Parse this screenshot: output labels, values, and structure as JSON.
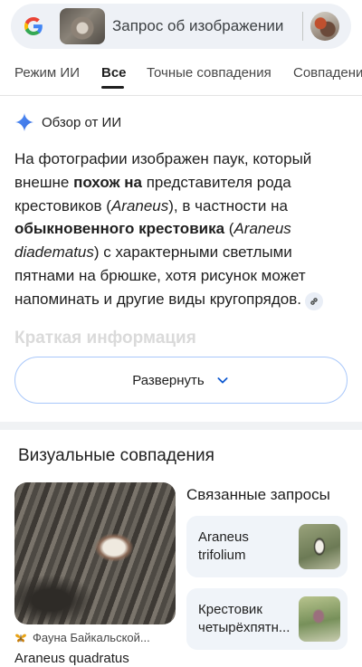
{
  "search": {
    "query_text": "Запрос об изображении",
    "logo": "google-g-icon"
  },
  "tabs": [
    {
      "label": "Режим ИИ",
      "active": false
    },
    {
      "label": "Все",
      "active": true
    },
    {
      "label": "Точные совпадения",
      "active": false
    },
    {
      "label": "Совпадени",
      "active": false
    }
  ],
  "ai_overview": {
    "title": "Обзор от ИИ",
    "icon": "gemini-sparkle-icon",
    "text_parts": {
      "p1": "На фотографии изображен паук, который внешне ",
      "b1": "похож на",
      "p2": " представителя рода крестовиков (",
      "i1": "Araneus",
      "p3": "), в частности на ",
      "b2": "обыкновенного крестовика",
      "p4": " (",
      "i2": "Araneus diadematus",
      "p5": ") с характерными светлыми пятнами на брюшке, хотя рисунок может напоминать и другие виды кругопрядов."
    },
    "faded_heading": "Краткая информация",
    "expand_label": "Развернуть"
  },
  "visual_matches": {
    "title": "Визуальные совпадения",
    "main_card": {
      "source": "Фауна Байкальской...",
      "caption": "Araneus quadratus"
    },
    "related": {
      "title": "Связанные запросы",
      "items": [
        {
          "label": "Araneus trifolium"
        },
        {
          "label": "Крестовик четырёхпятн..."
        }
      ]
    }
  },
  "colors": {
    "accent_blue": "#4285f4",
    "search_bg": "#eef1f6",
    "chip_bg": "#f0f4f9",
    "button_border": "#a8c7fa"
  }
}
